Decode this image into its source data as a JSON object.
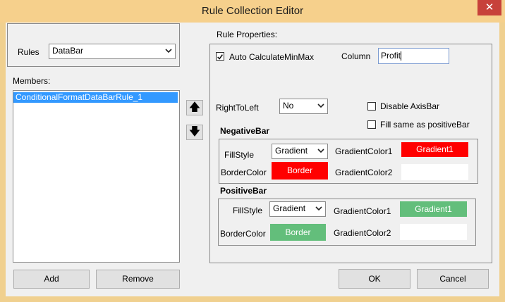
{
  "window": {
    "title": "Rule Collection Editor",
    "close_glyph": "✕"
  },
  "rules": {
    "label": "Rules",
    "value": "DataBar"
  },
  "members": {
    "label": "Members:",
    "items": [
      "ConditionalFormatDataBarRule_1"
    ]
  },
  "move": {
    "up_glyph": "🡅",
    "down_glyph": "🡇"
  },
  "buttons": {
    "add": "Add",
    "remove": "Remove",
    "ok": "OK",
    "cancel": "Cancel"
  },
  "rule_properties": {
    "label": "Rule Properties:",
    "auto_calc": {
      "label": "Auto CalculateMinMax",
      "checked": true
    },
    "column": {
      "label": "Column",
      "value": "Profit"
    },
    "right_to_left": {
      "label": "RightToLeft",
      "value": "No"
    },
    "disable_axisbar": {
      "label": "Disable AxisBar",
      "checked": false
    },
    "fill_same": {
      "label": "Fill same as positiveBar",
      "checked": false
    },
    "negative_bar": {
      "label": "NegativeBar",
      "fillstyle_label": "FillStyle",
      "fillstyle_value": "Gradient",
      "bordercolor_label": "BorderColor",
      "border_swatch_text": "Border",
      "gradient1_label": "GradientColor1",
      "gradient1_text": "Gradient1",
      "gradient2_label": "GradientColor2",
      "colors": {
        "border": "#ff0000",
        "gradient1": "#ff0000",
        "gradient2": "#ffffff"
      }
    },
    "positive_bar": {
      "label": "PositiveBar",
      "fillstyle_label": "FillStyle",
      "fillstyle_value": "Gradient",
      "bordercolor_label": "BorderColor",
      "border_swatch_text": "Border",
      "gradient1_label": "GradientColor1",
      "gradient1_text": "Gradient1",
      "gradient2_label": "GradientColor2",
      "colors": {
        "border": "#63be7b",
        "gradient1": "#63be7b",
        "gradient2": "#ffffff"
      }
    }
  }
}
